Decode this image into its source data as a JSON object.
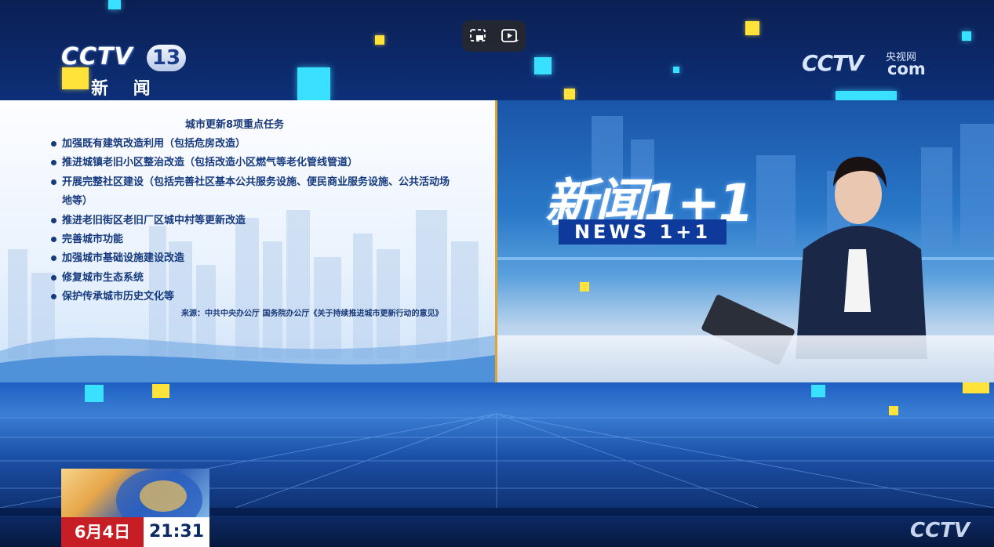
{
  "player": {
    "controls": [
      {
        "name": "exit-fullscreen-icon"
      },
      {
        "name": "ai-play-icon"
      }
    ]
  },
  "channel": {
    "logo_text": "CCTV",
    "number": "13",
    "name": "新 闻"
  },
  "site_logo": {
    "text": "CCTV",
    "cn": "央视网",
    "domain": "com"
  },
  "panel": {
    "title": "城市更新8项重点任务",
    "items": [
      "加强既有建筑改造利用（包括危房改造）",
      "推进城镇老旧小区整治改造（包括改造小区燃气等老化管线管道）",
      "开展完整社区建设（包括完善社区基本公共服务设施、便民商业服务设施、公共活动场地等）",
      "推进老旧街区老旧厂区城中村等更新改造",
      "完善城市功能",
      "加强城市基础设施建设改造",
      "修复城市生态系统",
      "保护传承城市历史文化等"
    ],
    "source": "来源：中共中央办公厅 国务院办公厅《关于持续推进城市更新行动的意见》"
  },
  "show": {
    "title_cn": "新闻1+1",
    "title_en": "NEWS 1+1"
  },
  "ticker": {
    "date": "6月4日",
    "time": "21:31",
    "corner_logo": "CCTV"
  },
  "colors": {
    "accent_yellow": "#ffe23a",
    "accent_cyan": "#39e0ff",
    "date_red": "#c71d24",
    "panel_text": "#163a7e"
  }
}
